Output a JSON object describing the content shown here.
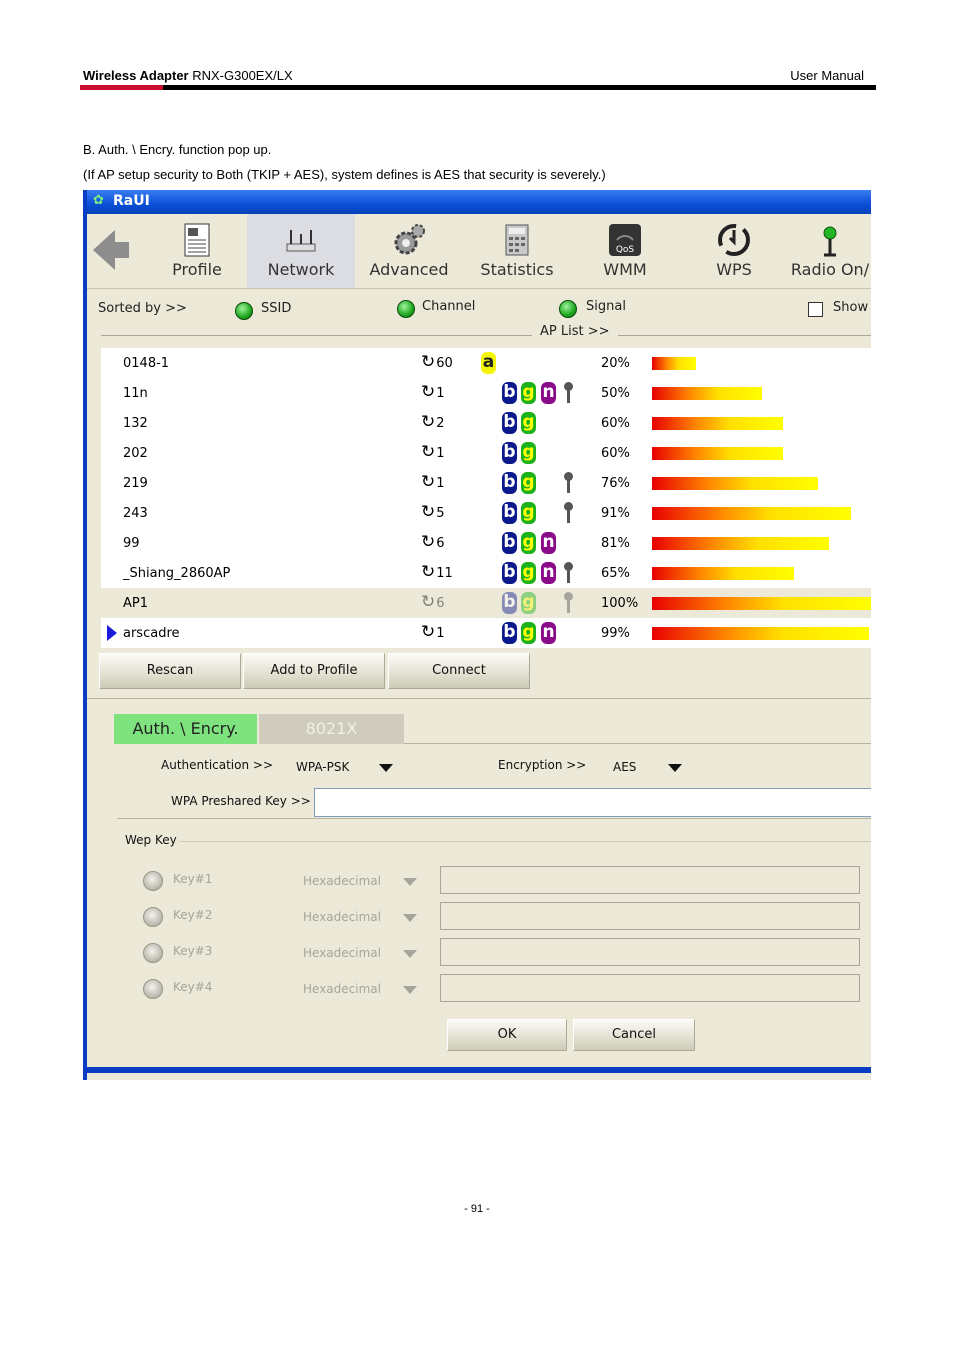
{
  "header": {
    "product_bold": "Wireless Adapter",
    "product_rest": " RNX-G300EX/LX",
    "right": "User Manual"
  },
  "intro": {
    "line1": "B. Auth. \\ Encry. function pop up.",
    "line2": "(If AP setup security to Both (TKIP + AES), system defines is AES that security is severely.)"
  },
  "footer": {
    "page": "- 91 -"
  },
  "window": {
    "title": "RaUI",
    "toolbar": [
      "Profile",
      "Network",
      "Advanced",
      "Statistics",
      "WMM",
      "WPS",
      "Radio On/"
    ],
    "sort": {
      "sorted_by": "Sorted by >>",
      "ssid": "SSID",
      "channel": "Channel",
      "signal": "Signal",
      "show": "Show",
      "ap_list": "AP List >>"
    },
    "ap_list": [
      {
        "ssid": "0148-1",
        "channel": "60",
        "modes": [
          "a"
        ],
        "secure": false,
        "signal": "20%",
        "signal_value": 20
      },
      {
        "ssid": "11n",
        "channel": "1",
        "modes": [
          "b",
          "g",
          "n"
        ],
        "secure": true,
        "signal": "50%",
        "signal_value": 50
      },
      {
        "ssid": "132",
        "channel": "2",
        "modes": [
          "b",
          "g"
        ],
        "secure": false,
        "signal": "60%",
        "signal_value": 60
      },
      {
        "ssid": "202",
        "channel": "1",
        "modes": [
          "b",
          "g"
        ],
        "secure": false,
        "signal": "60%",
        "signal_value": 60
      },
      {
        "ssid": "219",
        "channel": "1",
        "modes": [
          "b",
          "g"
        ],
        "secure": true,
        "signal": "76%",
        "signal_value": 76
      },
      {
        "ssid": "243",
        "channel": "5",
        "modes": [
          "b",
          "g"
        ],
        "secure": true,
        "signal": "91%",
        "signal_value": 91
      },
      {
        "ssid": "99",
        "channel": "6",
        "modes": [
          "b",
          "g",
          "n"
        ],
        "secure": false,
        "signal": "81%",
        "signal_value": 81
      },
      {
        "ssid": "_Shiang_2860AP",
        "channel": "11",
        "modes": [
          "b",
          "g",
          "n"
        ],
        "secure": true,
        "signal": "65%",
        "signal_value": 65
      },
      {
        "ssid": "AP1",
        "channel": "6",
        "modes": [
          "b",
          "g"
        ],
        "secure": true,
        "signal": "100%",
        "signal_value": 100,
        "selected": true
      },
      {
        "ssid": "arscadre",
        "channel": "1",
        "modes": [
          "b",
          "g",
          "n"
        ],
        "secure": false,
        "signal": "99%",
        "signal_value": 99,
        "connected": true
      }
    ],
    "buttons": {
      "rescan": "Rescan",
      "add_profile": "Add to Profile",
      "connect": "Connect"
    },
    "tabs": {
      "auth": "Auth. \\ Encry.",
      "dot1x": "8021X"
    },
    "auth": {
      "auth_label": "Authentication >>",
      "auth_value": "WPA-PSK",
      "enc_label": "Encryption >>",
      "enc_value": "AES",
      "psk_label": "WPA Preshared Key >>",
      "psk_value": ""
    },
    "wep": {
      "label": "Wep Key",
      "keys": [
        {
          "name": "Key#1",
          "format": "Hexadecimal"
        },
        {
          "name": "Key#2",
          "format": "Hexadecimal"
        },
        {
          "name": "Key#3",
          "format": "Hexadecimal"
        },
        {
          "name": "Key#4",
          "format": "Hexadecimal"
        }
      ]
    },
    "ok": "OK",
    "cancel": "Cancel"
  }
}
